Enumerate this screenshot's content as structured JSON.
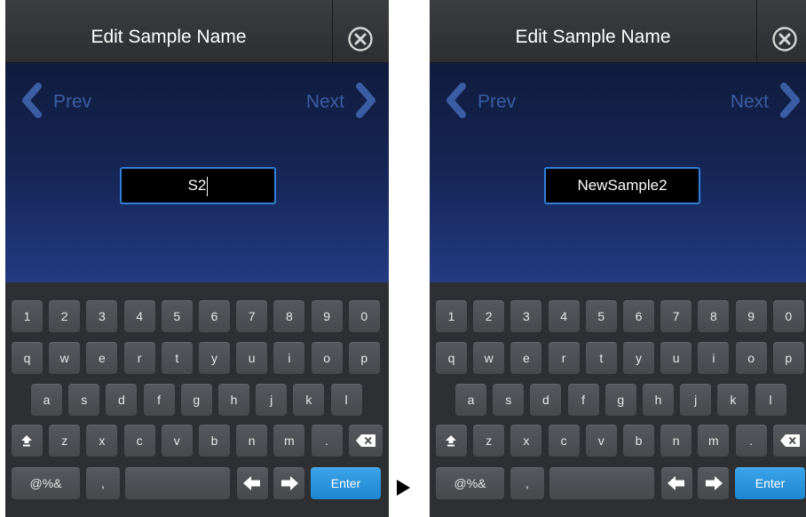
{
  "screens": [
    {
      "title": "Edit Sample Name",
      "prev_label": "Prev",
      "next_label": "Next",
      "input_value": "S2",
      "input_focused": true
    },
    {
      "title": "Edit Sample Name",
      "prev_label": "Prev",
      "next_label": "Next",
      "input_value": "NewSample2",
      "input_focused": false
    }
  ],
  "keyboard": {
    "row1": [
      "1",
      "2",
      "3",
      "4",
      "5",
      "6",
      "7",
      "8",
      "9",
      "0"
    ],
    "row2": [
      "q",
      "w",
      "e",
      "r",
      "t",
      "y",
      "u",
      "i",
      "o",
      "p"
    ],
    "row3": [
      "a",
      "s",
      "d",
      "f",
      "g",
      "h",
      "j",
      "k",
      "l"
    ],
    "row4": [
      "z",
      "x",
      "c",
      "v",
      "b",
      "n",
      "m",
      "."
    ],
    "symbols_label": "@%&",
    "comma_label": ",",
    "enter_label": "Enter",
    "icons": {
      "shift": "shift-icon",
      "backspace": "backspace-icon",
      "left": "arrow-left-icon",
      "right": "arrow-right-icon",
      "close": "close-icon",
      "prev": "chevron-left-icon",
      "next": "chevron-right-icon"
    }
  },
  "colors": {
    "accent": "#2e7fd9",
    "enter": "#2a95de",
    "nav_text": "#3a5da3",
    "key": "#4e5155",
    "keyboard_bg": "#2d2f33"
  }
}
